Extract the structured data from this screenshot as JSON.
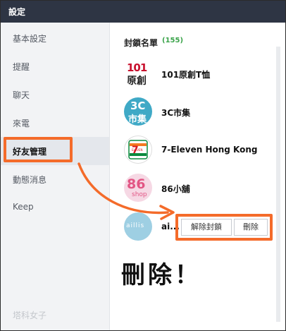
{
  "window": {
    "title": "設定"
  },
  "sidebar": {
    "items": [
      {
        "label": "基本設定"
      },
      {
        "label": "提醒"
      },
      {
        "label": "聊天"
      },
      {
        "label": "來電"
      },
      {
        "label": "好友管理"
      },
      {
        "label": "動態消息"
      },
      {
        "label": "Keep"
      }
    ],
    "active_index": 4
  },
  "blocked_list": {
    "title": "封鎖名單",
    "count": "(155)",
    "rows": [
      {
        "name": "101原創T恤",
        "avatar_text_1": "101",
        "avatar_text_2": "原創"
      },
      {
        "name": "3C市集",
        "avatar_text_1": "3C",
        "avatar_text_2": "市集"
      },
      {
        "name": "7-Eleven Hong Kong",
        "avatar_text_1": "ELEVEN"
      },
      {
        "name": "86小舖",
        "avatar_text_1": "86",
        "avatar_text_2": "shop"
      },
      {
        "name": "ai...",
        "avatar_text_1": "aillis"
      }
    ],
    "unblock_label": "解除封鎖",
    "delete_label": "刪除"
  },
  "annotation": {
    "text": "刪除！"
  },
  "watermark": {
    "text": "塔科女子"
  },
  "colors": {
    "titlebar": "#2e3544",
    "highlight": "#f46b2a",
    "count": "#3aa34a",
    "sidebar_bg": "#f2f3f5"
  }
}
